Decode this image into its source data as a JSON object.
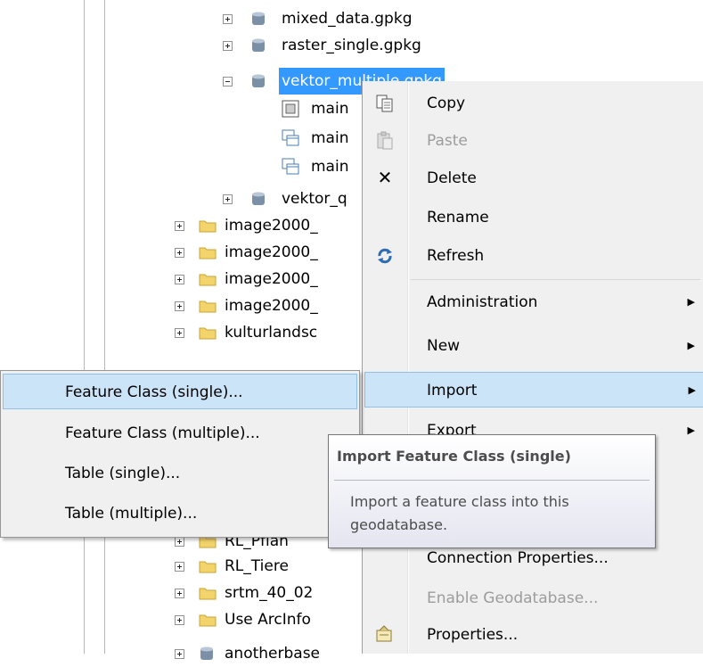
{
  "tree": {
    "items": [
      {
        "label": "mixed_data.gpkg",
        "kind": "db",
        "expander": "plus"
      },
      {
        "label": "raster_single.gpkg",
        "kind": "db",
        "expander": "plus"
      },
      {
        "label": "vektor_multiple.gpkg",
        "kind": "db",
        "expander": "minus",
        "selected": true
      },
      {
        "label": "main",
        "kind": "raster"
      },
      {
        "label": "main",
        "kind": "table"
      },
      {
        "label": "main",
        "kind": "table"
      },
      {
        "label": "vektor_q",
        "kind": "db",
        "expander": "plus"
      },
      {
        "label": "image2000_",
        "kind": "folder",
        "expander": "plus"
      },
      {
        "label": "image2000_",
        "kind": "folder",
        "expander": "plus"
      },
      {
        "label": "image2000_",
        "kind": "folder",
        "expander": "plus"
      },
      {
        "label": "image2000_",
        "kind": "folder",
        "expander": "plus"
      },
      {
        "label": "kulturlandsc",
        "kind": "folder",
        "expander": "plus"
      },
      {
        "label": "RL_Pflan",
        "kind": "folder",
        "expander": "plus"
      },
      {
        "label": "RL_Tiere",
        "kind": "folder",
        "expander": "plus"
      },
      {
        "label": "srtm_40_02",
        "kind": "folder",
        "expander": "plus"
      },
      {
        "label": "Use ArcInfo",
        "kind": "folder",
        "expander": "plus"
      },
      {
        "label": "anotherbase",
        "kind": "db",
        "expander": "plus"
      }
    ]
  },
  "context_menu": {
    "items": [
      {
        "label": "Copy",
        "icon": "copy-icon"
      },
      {
        "label": "Paste",
        "icon": "paste-icon",
        "disabled": true
      },
      {
        "label": "Delete",
        "icon": "delete-icon"
      },
      {
        "label": "Rename"
      },
      {
        "label": "Refresh",
        "icon": "refresh-icon"
      },
      {
        "label": "Administration",
        "submenu": true
      },
      {
        "label": "New",
        "submenu": true
      },
      {
        "label": "Import",
        "submenu": true,
        "hover": true
      },
      {
        "label": "Export",
        "submenu": true
      },
      {
        "label": "Connection Properties..."
      },
      {
        "label": "Enable Geodatabase...",
        "disabled": true
      },
      {
        "label": "Properties...",
        "icon": "properties-icon"
      }
    ]
  },
  "import_submenu": {
    "items": [
      {
        "label": "Feature Class (single)...",
        "hover": true
      },
      {
        "label": "Feature Class (multiple)..."
      },
      {
        "label": "Table (single)..."
      },
      {
        "label": "Table (multiple)..."
      }
    ]
  },
  "tooltip": {
    "title": "Import Feature Class (single)",
    "body": "Import a feature class into this geodatabase."
  },
  "colors": {
    "selection": "#3399ff",
    "hover_bg": "#cce4f7",
    "hover_border": "#8fc0ea",
    "menu_bg": "#f0f0f0"
  }
}
